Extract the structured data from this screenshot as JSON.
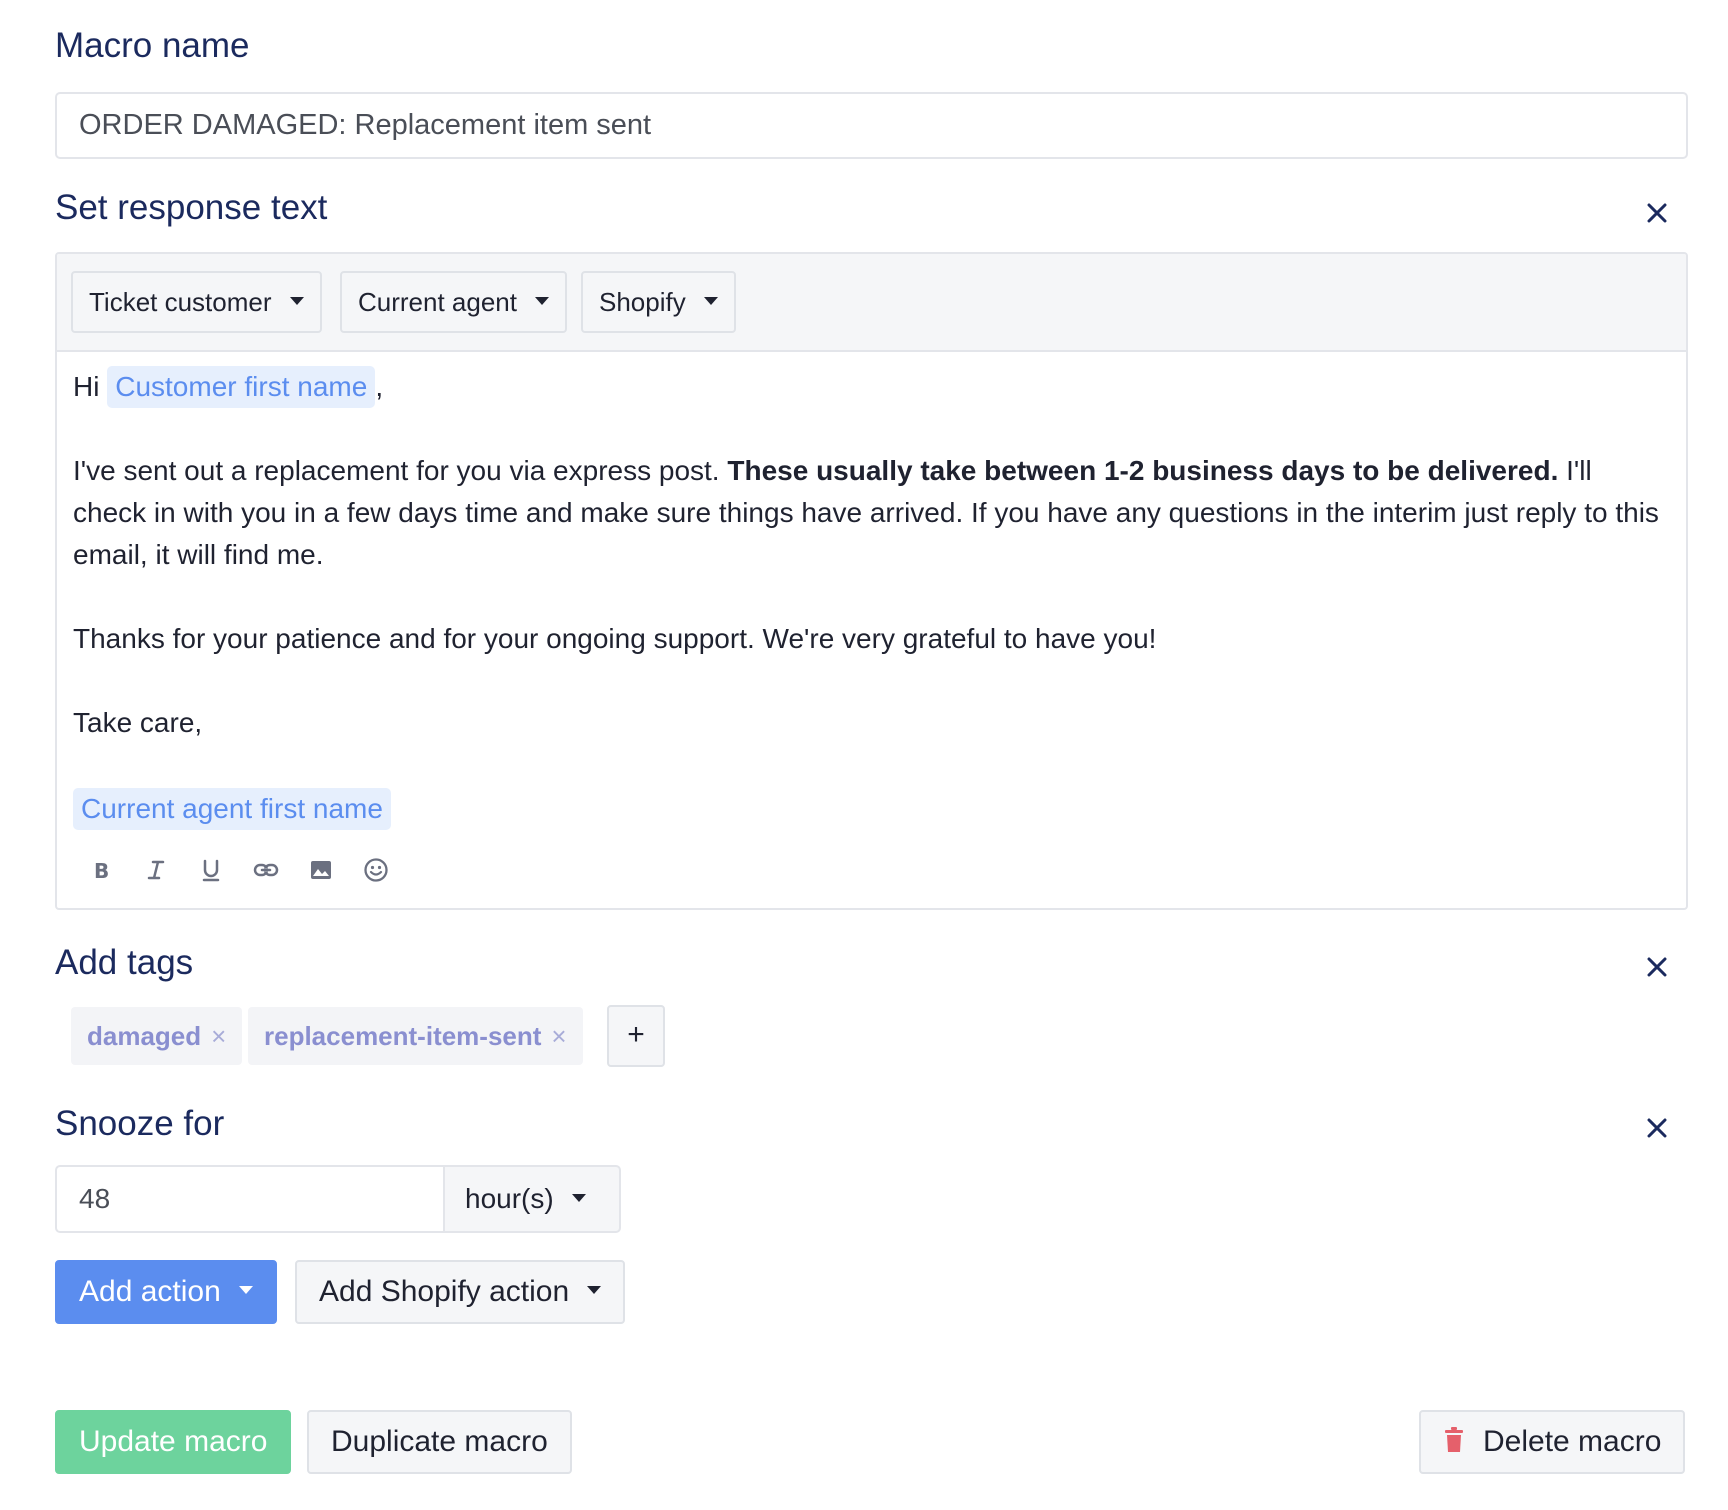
{
  "macro_name": {
    "title": "Macro name",
    "value": "ORDER DAMAGED: Replacement item sent"
  },
  "response_text": {
    "title": "Set response text",
    "variable_menus": [
      "Ticket customer",
      "Current agent",
      "Shopify"
    ],
    "greeting": "Hi",
    "customer_chip": "Customer first name",
    "greeting_comma": ",",
    "para1_plain": "I've sent out a replacement for you via express post. ",
    "para1_bold": "These usually take between 1-2 business days to be delivered.",
    "para1_rest": "I'll check in with you in a few days time and make sure things have arrived. If you have any questions in the interim just reply to this email, it will find me.",
    "para2": "Thanks for your patience and for your ongoing support. We're very grateful to have you!",
    "signoff": "Take care,",
    "agent_chip": "Current agent first name",
    "format_icons": [
      "bold-icon",
      "italic-icon",
      "underline-icon",
      "link-icon",
      "image-icon",
      "emoji-icon"
    ]
  },
  "tags": {
    "title": "Add tags",
    "items": [
      "damaged",
      "replacement-item-sent"
    ],
    "remove_glyph": "×",
    "add_glyph": "+"
  },
  "snooze": {
    "title": "Snooze for",
    "value": "48",
    "unit": "hour(s)"
  },
  "actions": {
    "add_action": "Add action",
    "add_shopify_action": "Add Shopify action"
  },
  "footer": {
    "update": "Update macro",
    "duplicate": "Duplicate macro",
    "delete": "Delete macro"
  },
  "colors": {
    "heading": "#1b2a5e",
    "primary": "#5b8def",
    "success": "#6dd39d",
    "chip_bg": "#e6effd",
    "tag_text": "#8a8fd0",
    "danger": "#e5606b"
  }
}
